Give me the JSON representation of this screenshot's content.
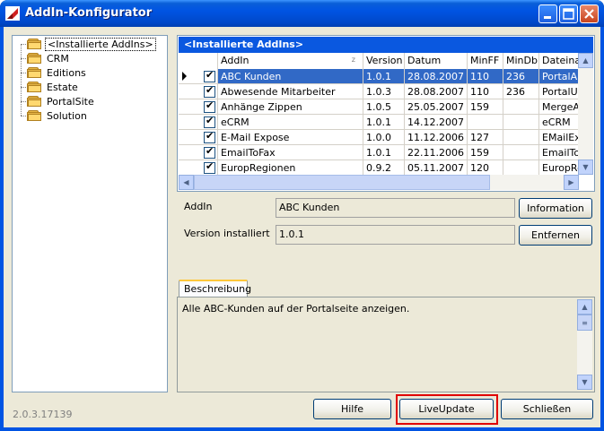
{
  "window": {
    "title": "AddIn-Konfigurator"
  },
  "tree": {
    "items": [
      {
        "label": "<Installierte AddIns>",
        "selected": true
      },
      {
        "label": "CRM"
      },
      {
        "label": "Editions"
      },
      {
        "label": "Estate"
      },
      {
        "label": "PortalSite"
      },
      {
        "label": "Solution"
      }
    ]
  },
  "grid": {
    "title": "<Installierte AddIns>",
    "columns": [
      "AddIn",
      "Version",
      "Datum",
      "MinFF",
      "MinDb",
      "Dateinar"
    ],
    "sort_indicator": "z",
    "rows": [
      {
        "checked": true,
        "addin": "ABC Kunden",
        "version": "1.0.1",
        "datum": "28.08.2007",
        "minff": "110",
        "mindb": "236",
        "datei": "PortalAB"
      },
      {
        "checked": true,
        "addin": "Abwesende Mitarbeiter",
        "version": "1.0.3",
        "datum": "28.08.2007",
        "minff": "110",
        "mindb": "236",
        "datei": "PortalUs"
      },
      {
        "checked": true,
        "addin": "Anhänge Zippen",
        "version": "1.0.5",
        "datum": "25.05.2007",
        "minff": "159",
        "mindb": "",
        "datei": "MergeAtt"
      },
      {
        "checked": true,
        "addin": "eCRM",
        "version": "1.0.1",
        "datum": "14.12.2007",
        "minff": "",
        "mindb": "",
        "datei": "eCRM"
      },
      {
        "checked": true,
        "addin": "E-Mail Expose",
        "version": "1.0.0",
        "datum": "11.12.2006",
        "minff": "127",
        "mindb": "",
        "datei": "EMailExp"
      },
      {
        "checked": true,
        "addin": "EmailToFax",
        "version": "1.0.1",
        "datum": "22.11.2006",
        "minff": "159",
        "mindb": "",
        "datei": "EmailToF"
      },
      {
        "checked": true,
        "addin": "EuropRegionen",
        "version": "0.9.2",
        "datum": "05.11.2007",
        "minff": "120",
        "mindb": "",
        "datei": "EuropRe"
      }
    ]
  },
  "details": {
    "addin_label": "AddIn",
    "addin_value": "ABC Kunden",
    "version_label": "Version installiert",
    "version_value": "1.0.1",
    "information_button": "Information",
    "remove_button": "Entfernen"
  },
  "description": {
    "tab_label": "Beschreibung",
    "text": "Alle ABC-Kunden auf der Portalseite anzeigen."
  },
  "footer": {
    "version": "2.0.3.17139",
    "help_button": "Hilfe",
    "liveupdate_button": "LiveUpdate",
    "close_button": "Schließen"
  },
  "colors": {
    "titlebar": "#0054e3",
    "selection": "#3169c6",
    "highlight_box": "#e00000",
    "grid_title": "#0a58e0"
  }
}
